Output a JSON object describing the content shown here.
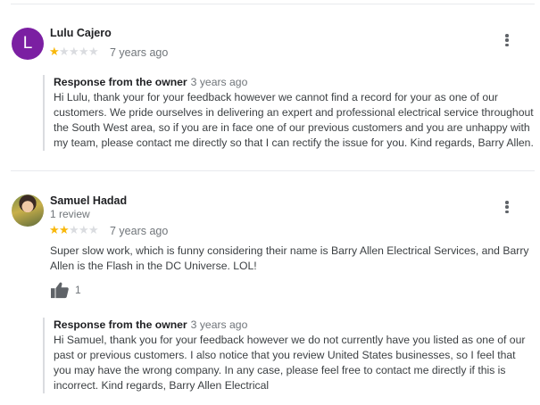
{
  "reviews": [
    {
      "avatar_letter": "L",
      "avatar_color": "#7b1fa2",
      "name": "Lulu Cajero",
      "review_count": "",
      "rating": 1,
      "time": "7 years ago",
      "text": "",
      "likes": "",
      "owner_response": {
        "label": "Response from the owner",
        "time": "3 years ago",
        "text": "Hi Lulu, thank your for your feedback however we cannot find a record for your as one of our customers. We pride ourselves in delivering an expert and professional electrical service throughout the South West area, so if you are in face one of our previous customers and you are unhappy with my team, please contact me directly so that I can rectify the issue for you. Kind regards, Barry Allen."
      }
    },
    {
      "avatar_letter": "",
      "name": "Samuel Hadad",
      "review_count": "1 review",
      "rating": 2,
      "time": "7 years ago",
      "text": "Super slow work, which is funny considering their name is Barry Allen Electrical Services, and Barry Allen is the Flash in the DC Universe. LOL!",
      "likes": "1",
      "owner_response": {
        "label": "Response from the owner",
        "time": "3 years ago",
        "text": "Hi Samuel, thank you for your feedback however we do not currently have you listed as one of our past or previous customers. I also notice that you review United States businesses, so I feel that you may have the wrong company. In any case, please feel free to contact me directly if this is incorrect. Kind regards, Barry Allen Electrical"
      }
    }
  ],
  "icons": {
    "star": "star-icon",
    "more": "more-vert-icon",
    "like": "thumb-up-icon"
  },
  "colors": {
    "star_on": "#f8b80b",
    "star_off": "#dadce0",
    "text_muted": "#70757a"
  }
}
